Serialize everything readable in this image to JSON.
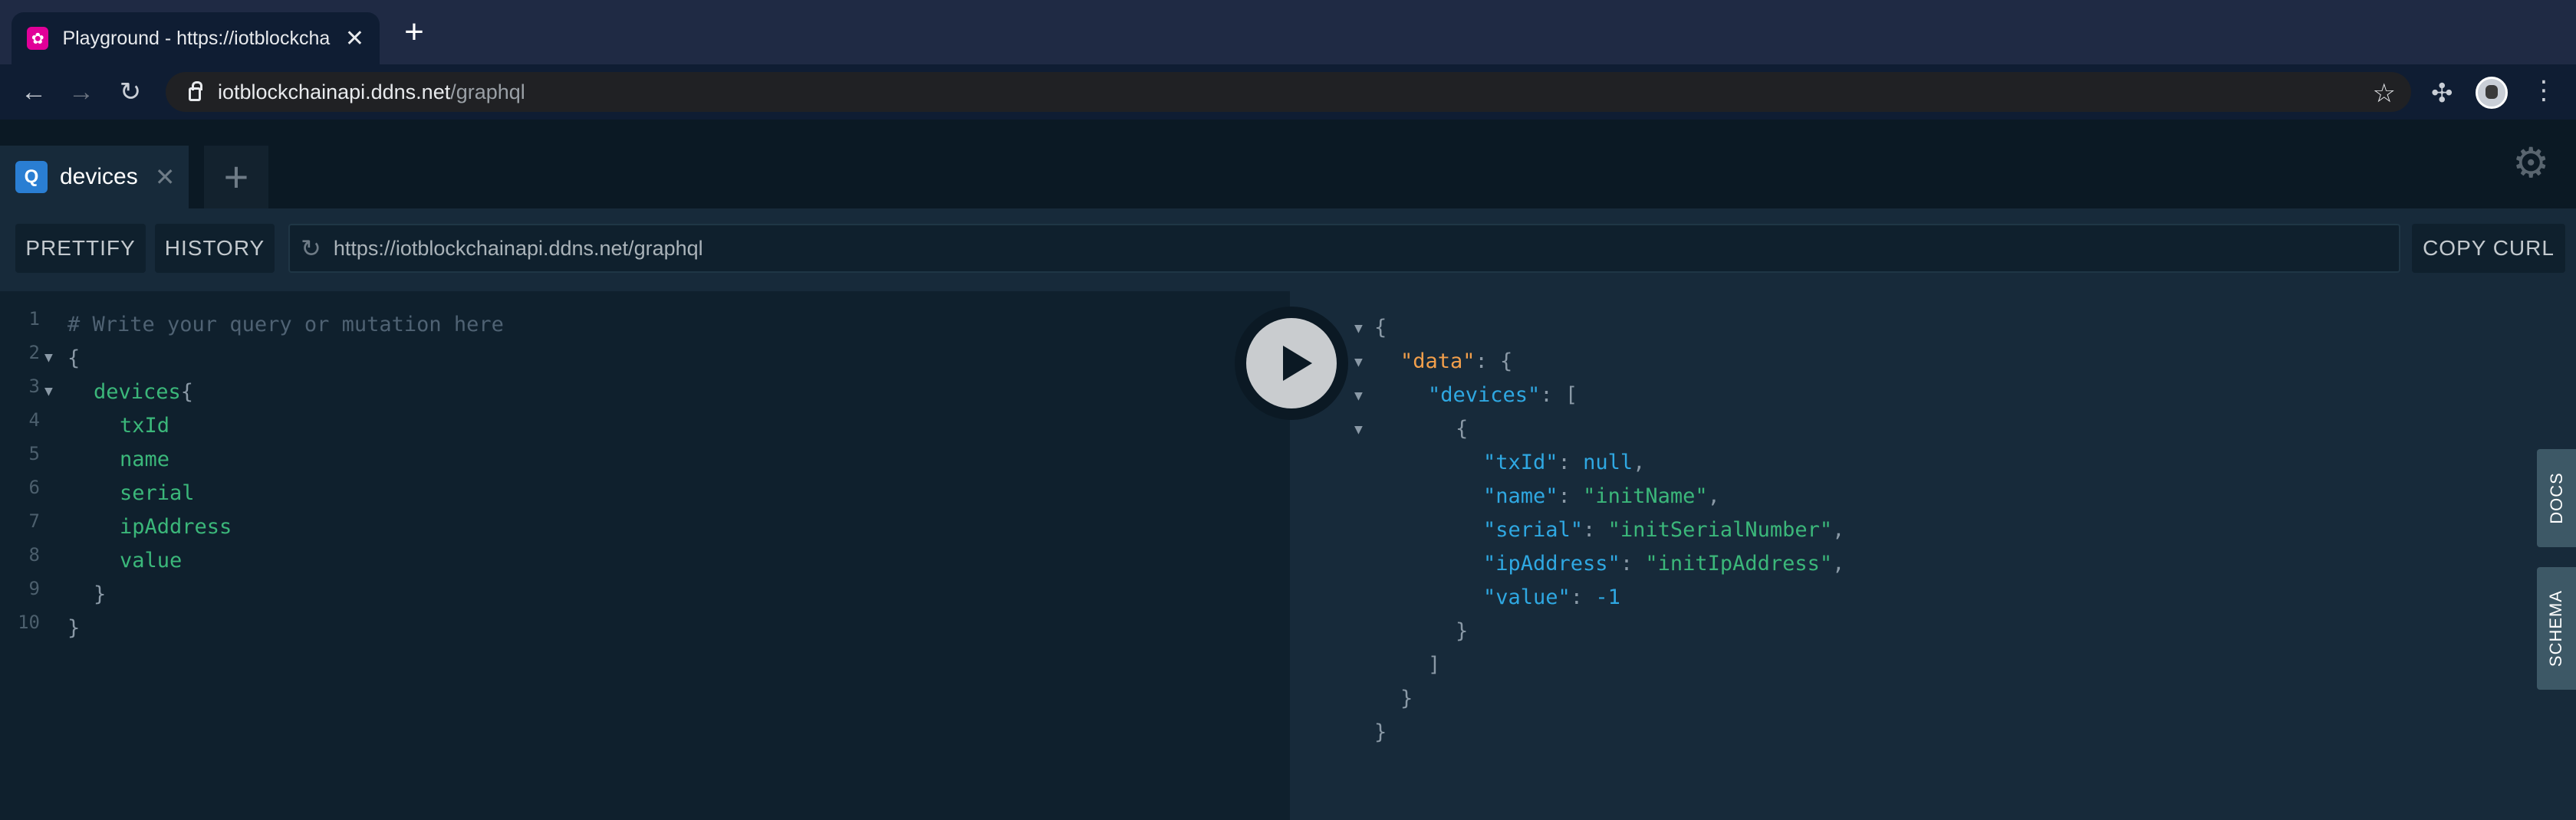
{
  "browser": {
    "tab_title": "Playground - https://iotblockcha",
    "tab_close": "✕",
    "new_tab": "+",
    "url_host": "iotblockchainapi.ddns.net",
    "url_path": "/graphql"
  },
  "playground": {
    "query_tab": {
      "badge": "Q",
      "name": "devices",
      "close": "✕"
    },
    "add_tab": "+",
    "prettify_label": "PRETTIFY",
    "history_label": "HISTORY",
    "endpoint": "https://iotblockchainapi.ddns.net/graphql",
    "copy_curl_label": "COPY CURL",
    "docs_label": "DOCS",
    "schema_label": "SCHEMA"
  },
  "editor": {
    "line_numbers": [
      "1",
      "2",
      "3",
      "4",
      "5",
      "6",
      "7",
      "8",
      "9",
      "10"
    ],
    "comment": "# Write your query or mutation here",
    "open_brace": "{",
    "devices_field": "devices",
    "fields": [
      "txId",
      "name",
      "serial",
      "ipAddress",
      "value"
    ],
    "close_inner": "}",
    "close_outer": "}"
  },
  "result": {
    "data_key": "\"data\"",
    "devices_key": "\"devices\"",
    "txId_key": "\"txId\"",
    "txId_val": "null",
    "name_key": "\"name\"",
    "name_val": "\"initName\"",
    "serial_key": "\"serial\"",
    "serial_val": "\"initSerialNumber\"",
    "ip_key": "\"ipAddress\"",
    "ip_val": "\"initIpAddress\"",
    "value_key": "\"value\"",
    "value_val": "-1"
  },
  "colors": {
    "editor_bg": "#0f202d",
    "results_bg": "#172a3a",
    "field_green": "#3bb77a",
    "key_blue": "#2fa8e2",
    "data_orange": "#f29f4b",
    "graphql_pink": "#e10098"
  }
}
